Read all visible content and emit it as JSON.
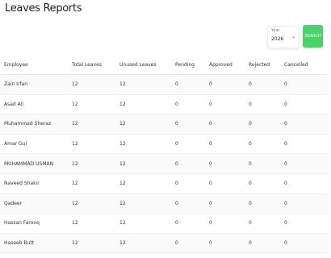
{
  "page": {
    "title": "Leaves Reports"
  },
  "filter": {
    "year_label": "Year",
    "year_value": "2026",
    "search_label": "SEARCH"
  },
  "table": {
    "columns": [
      "Employee",
      "Total Leaves",
      "Unused Leaves",
      "Pending",
      "Approved",
      "Rejected",
      "Cancelled"
    ],
    "rows": [
      [
        "Zain Irfan",
        "12",
        "12",
        "0",
        "0",
        "0",
        "0"
      ],
      [
        "Asad Ali",
        "12",
        "12",
        "0",
        "0",
        "0",
        "0"
      ],
      [
        "Muhammad Sheraz",
        "12",
        "12",
        "0",
        "0",
        "0",
        "0"
      ],
      [
        "Amar Gul",
        "12",
        "12",
        "0",
        "0",
        "0",
        "0"
      ],
      [
        "MUHAMMAD USMAN",
        "12",
        "12",
        "0",
        "0",
        "0",
        "0"
      ],
      [
        "Naveed Shakir",
        "12",
        "12",
        "0",
        "0",
        "0",
        "0"
      ],
      [
        "Qadeer",
        "12",
        "12",
        "0",
        "0",
        "0",
        "0"
      ],
      [
        "Hassan Farooq",
        "12",
        "12",
        "0",
        "0",
        "0",
        "0"
      ],
      [
        "Haseeb Butt",
        "12",
        "12",
        "0",
        "0",
        "0",
        "0"
      ]
    ]
  },
  "colors": {
    "search_button": "#4cd26a"
  }
}
